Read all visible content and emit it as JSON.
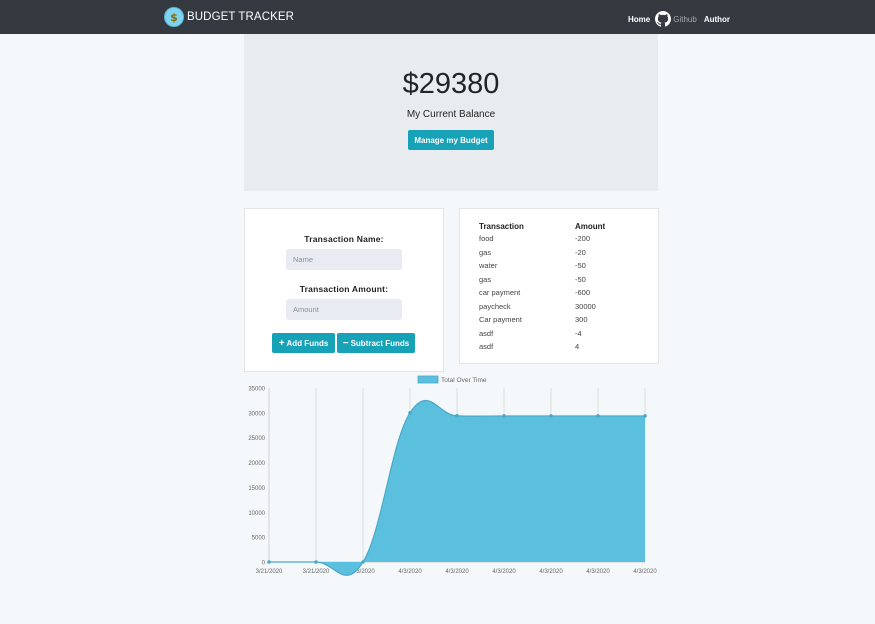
{
  "navbar": {
    "brand": "BUDGET TRACKER",
    "logo_glyph": "$",
    "links": {
      "home": "Home",
      "github": "Github",
      "author": "Author"
    },
    "icons": {
      "brand": "money-bag-icon",
      "github": "github-icon"
    },
    "background_color": "#343a40"
  },
  "balance": {
    "amount": "$29380",
    "label": "My Current Balance",
    "manage_button": "Manage my Budget"
  },
  "form": {
    "name_label": "Transaction Name:",
    "name_placeholder": "Name",
    "amount_label": "Transaction Amount:",
    "amount_placeholder": "Amount",
    "add_button": "Add Funds",
    "subtract_button": "Subtract Funds",
    "add_glyph": "+",
    "subtract_glyph": "−"
  },
  "transactions": {
    "headers": [
      "Transaction",
      "Amount"
    ],
    "rows": [
      [
        "food",
        "-200"
      ],
      [
        "gas",
        "-20"
      ],
      [
        "water",
        "-50"
      ],
      [
        "gas",
        "-50"
      ],
      [
        "car payment",
        "-600"
      ],
      [
        "paycheck",
        "30000"
      ],
      [
        "Car payment",
        "300"
      ],
      [
        "asdf",
        "-4"
      ],
      [
        "asdf",
        "4"
      ]
    ]
  },
  "colors": {
    "accent": "#17a2b8",
    "chart_fill": "#5bbfde",
    "chart_line": "#4aa9c9"
  },
  "chart_data": {
    "type": "area",
    "legend": [
      "Total Over Time"
    ],
    "legend_position": "top",
    "x": [
      "3/21/2020",
      "3/21/2020",
      "4/3/2020",
      "4/3/2020",
      "4/3/2020",
      "4/3/2020",
      "4/3/2020",
      "4/3/2020",
      "4/3/2020"
    ],
    "series": [
      {
        "name": "Total Over Time",
        "values": [
          0,
          0,
          0,
          30000,
          29400,
          29380,
          29380,
          29380,
          29380
        ]
      }
    ],
    "y_ticks": [
      "0",
      "5000",
      "10000",
      "15000",
      "20000",
      "25000",
      "30000",
      "35000"
    ],
    "ylim": [
      0,
      35000
    ],
    "grid": "vertical"
  }
}
